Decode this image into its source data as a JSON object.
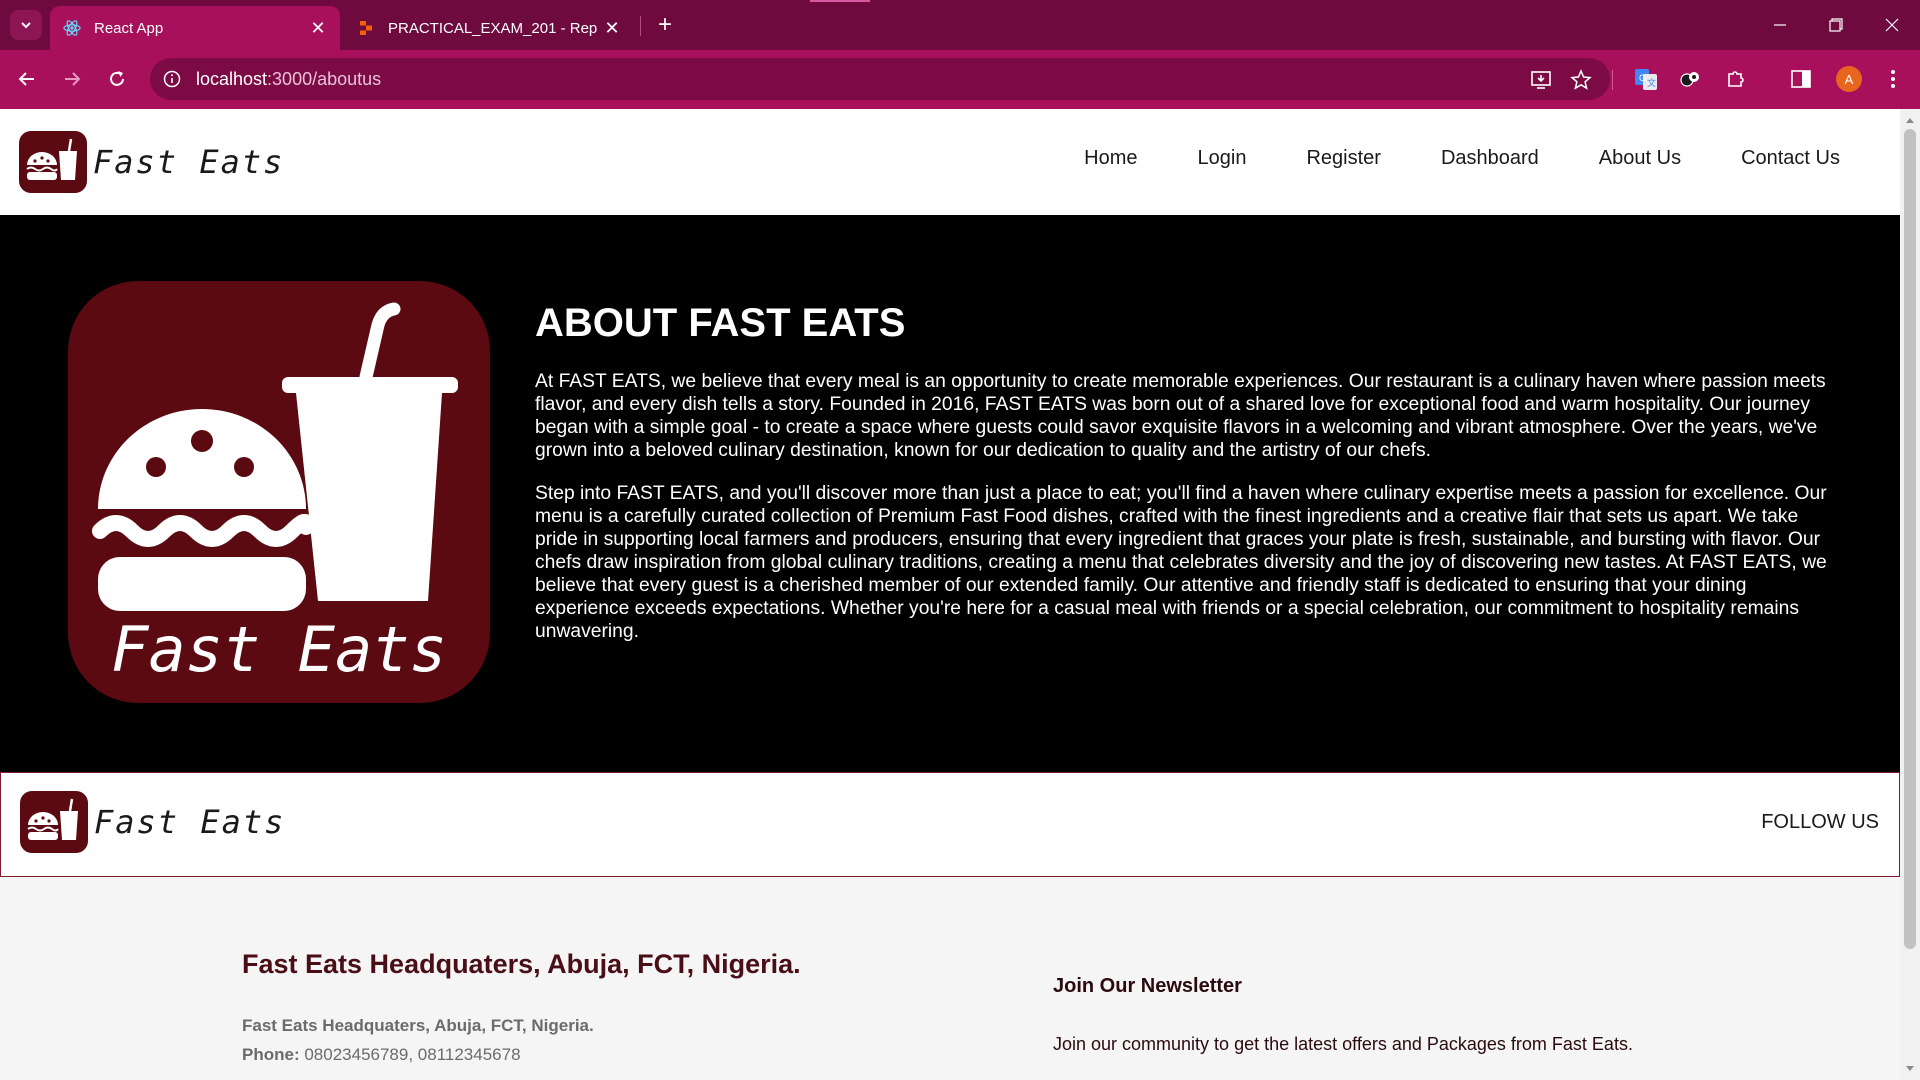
{
  "browser": {
    "tabs": [
      {
        "title": "React App",
        "active": true,
        "favicon": "react-icon"
      },
      {
        "title": "PRACTICAL_EXAM_201 - Replit",
        "active": false,
        "favicon": "replit-icon"
      }
    ],
    "close_glyph": "✕",
    "new_tab_glyph": "+",
    "url_host": "localhost",
    "url_path": ":3000/aboutus",
    "profile_initial": "A",
    "colors": {
      "titlebar": "#6e0a3e",
      "toolbar": "#a8105c",
      "omnibox": "#7c0b45"
    }
  },
  "header": {
    "brand": "Fast Eats",
    "nav": [
      "Home",
      "Login",
      "Register",
      "Dashboard",
      "About Us",
      "Contact Us"
    ]
  },
  "about": {
    "heading": "ABOUT FAST EATS",
    "logo_text": "Fast Eats",
    "paragraphs": [
      "At FAST EATS, we believe that every meal is an opportunity to create memorable experiences. Our restaurant is a culinary haven where passion meets flavor, and every dish tells a story. Founded in 2016, FAST EATS was born out of a shared love for exceptional food and warm hospitality. Our journey began with a simple goal - to create a space where guests could savor exquisite flavors in a welcoming and vibrant atmosphere. Over the years, we've grown into a beloved culinary destination, known for our dedication to quality and the artistry of our chefs.",
      "Step into FAST EATS, and you'll discover more than just a place to eat; you'll find a haven where culinary expertise meets a passion for excellence. Our menu is a carefully curated collection of Premium Fast Food dishes, crafted with the finest ingredients and a creative flair that sets us apart. We take pride in supporting local farmers and producers, ensuring that every ingredient that graces your plate is fresh, sustainable, and bursting with flavor. Our chefs draw inspiration from global culinary traditions, creating a menu that celebrates diversity and the joy of discovering new tastes. At FAST EATS, we believe that every guest is a cherished member of our extended family. Our attentive and friendly staff is dedicated to ensuring that your dining experience exceeds expectations. Whether you're here for a casual meal with friends or a special celebration, our commitment to hospitality remains unwavering."
    ],
    "brand_color": "#5a0a10"
  },
  "footer": {
    "brand": "Fast Eats",
    "follow": "FOLLOW US",
    "hq_title": "Fast Eats Headquaters, Abuja, FCT, Nigeria.",
    "hq_address": "Fast Eats Headquaters, Abuja, FCT, Nigeria.",
    "phone_label": "Phone:",
    "phone_value": "08023456789, 08112345678",
    "newsletter_title": "Join Our Newsletter",
    "newsletter_text": "Join our community to get the latest offers and Packages from Fast Eats."
  }
}
